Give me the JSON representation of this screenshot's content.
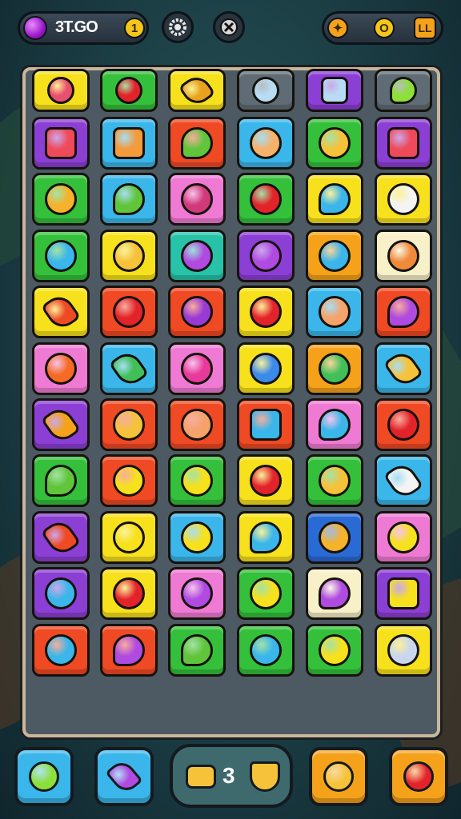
{
  "hud": {
    "score": "3T.GO",
    "coin_value": "1",
    "right_coin": "O",
    "right_square": "LL",
    "gem_color": "#9b18c9",
    "icons": [
      "gem-icon",
      "coin-icon",
      "gear-icon",
      "gear-icon",
      "flag-icon",
      "coin-icon",
      "square-icon"
    ]
  },
  "board": {
    "rows": [
      [
        {
          "bg": "#f7e11d",
          "icon": "plum",
          "c": "#e8516e"
        },
        {
          "bg": "#34c03b",
          "icon": "apple",
          "c": "#e3232a"
        },
        {
          "bg": "#f7e11d",
          "icon": "carrot",
          "c": "#e8a21d"
        },
        {
          "bg": "#4d5a63",
          "icon": "magnifier",
          "c": "#b7dcf4"
        },
        {
          "bg": "#8b3fd4",
          "icon": "battery",
          "c": "#b7dcf4"
        },
        {
          "bg": "#4d5a63",
          "icon": "leaf",
          "c": "#8de03a"
        }
      ],
      [
        {
          "bg": "#8b3fd4",
          "icon": "jar",
          "c": "#ef4a5a"
        },
        {
          "bg": "#3ab6ea",
          "icon": "cake",
          "c": "#f39a3a"
        },
        {
          "bg": "#ef4a24",
          "icon": "leaf",
          "c": "#61c53c"
        },
        {
          "bg": "#3ab6ea",
          "icon": "face",
          "c": "#f5b26b"
        },
        {
          "bg": "#34c03b",
          "icon": "cross",
          "c": "#f5c23a"
        },
        {
          "bg": "#8b3fd4",
          "icon": "frame",
          "c": "#ef4a5a"
        }
      ],
      [
        {
          "bg": "#34c03b",
          "icon": "corn",
          "c": "#f5b22a"
        },
        {
          "bg": "#3ab6ea",
          "icon": "leaf",
          "c": "#61c53c"
        },
        {
          "bg": "#ef7ad4",
          "icon": "bike",
          "c": "#d13a7a"
        },
        {
          "bg": "#34c03b",
          "icon": "tomato",
          "c": "#e3232a"
        },
        {
          "bg": "#f7e11d",
          "icon": "balloon",
          "c": "#3ab6ea"
        },
        {
          "bg": "#f7e11d",
          "icon": "cloud",
          "c": "#f4f4f4"
        }
      ],
      [
        {
          "bg": "#34c03b",
          "icon": "blob",
          "c": "#3ab6ea"
        },
        {
          "bg": "#f7e11d",
          "icon": "bee",
          "c": "#f5c23a"
        },
        {
          "bg": "#27c2a8",
          "icon": "grape",
          "c": "#b04ae0"
        },
        {
          "bg": "#8b3fd4",
          "icon": "plum",
          "c": "#b04ae0"
        },
        {
          "bg": "#f5a21a",
          "icon": "hand",
          "c": "#3ab6ea"
        },
        {
          "bg": "#f7f0c8",
          "icon": "face",
          "c": "#ef8a3a"
        }
      ],
      [
        {
          "bg": "#f7e11d",
          "icon": "carrot",
          "c": "#ef4a24"
        },
        {
          "bg": "#ef4a24",
          "icon": "lantern",
          "c": "#e3232a"
        },
        {
          "bg": "#ef4a24",
          "icon": "berry",
          "c": "#9a3ad4"
        },
        {
          "bg": "#f7e11d",
          "icon": "apple",
          "c": "#e3232a"
        },
        {
          "bg": "#3ab6ea",
          "icon": "face",
          "c": "#f5a26b"
        },
        {
          "bg": "#ef4a24",
          "icon": "balloon",
          "c": "#b04ae0"
        }
      ],
      [
        {
          "bg": "#ef7ad4",
          "icon": "star",
          "c": "#f56a24"
        },
        {
          "bg": "#3ab6ea",
          "icon": "carrot",
          "c": "#41c05a"
        },
        {
          "bg": "#ef7ad4",
          "icon": "apple",
          "c": "#e83a9a"
        },
        {
          "bg": "#f7e11d",
          "icon": "blob",
          "c": "#3a8aea"
        },
        {
          "bg": "#f5a21a",
          "icon": "bottle",
          "c": "#41c05a"
        },
        {
          "bg": "#3ab6ea",
          "icon": "umbrella",
          "c": "#f5c23a"
        }
      ],
      [
        {
          "bg": "#8b3fd4",
          "icon": "key",
          "c": "#f5a21a"
        },
        {
          "bg": "#ef4a24",
          "icon": "corn",
          "c": "#f5c23a"
        },
        {
          "bg": "#ef4a24",
          "icon": "face",
          "c": "#f5a26b"
        },
        {
          "bg": "#ef4a24",
          "icon": "box",
          "c": "#3ab6ea"
        },
        {
          "bg": "#ef7ad4",
          "icon": "balloon",
          "c": "#3ab6ea"
        },
        {
          "bg": "#ef4a24",
          "icon": "tomato",
          "c": "#e3232a"
        }
      ],
      [
        {
          "bg": "#34c03b",
          "icon": "balloon",
          "c": "#61c53c"
        },
        {
          "bg": "#ef4a24",
          "icon": "face",
          "c": "#f7e11d"
        },
        {
          "bg": "#34c03b",
          "icon": "face",
          "c": "#f7e11d"
        },
        {
          "bg": "#f7e11d",
          "icon": "apple",
          "c": "#e3232a"
        },
        {
          "bg": "#34c03b",
          "icon": "coin",
          "c": "#f5c23a"
        },
        {
          "bg": "#3ab6ea",
          "icon": "hammer",
          "c": "#f4f4f4"
        }
      ],
      [
        {
          "bg": "#8b3fd4",
          "icon": "carrot",
          "c": "#ef4a24"
        },
        {
          "bg": "#f7e11d",
          "icon": "duck",
          "c": "#f7e11d"
        },
        {
          "bg": "#3ab6ea",
          "icon": "ring",
          "c": "#f7e11d"
        },
        {
          "bg": "#f7e11d",
          "icon": "balloon",
          "c": "#3ab6ea"
        },
        {
          "bg": "#2a6ad4",
          "icon": "corn",
          "c": "#f5b22a"
        },
        {
          "bg": "#ef7ad4",
          "icon": "face",
          "c": "#f7e11d"
        }
      ],
      [
        {
          "bg": "#8b3fd4",
          "icon": "gem",
          "c": "#3ab6ea"
        },
        {
          "bg": "#f7e11d",
          "icon": "berries",
          "c": "#e3232a"
        },
        {
          "bg": "#ef7ad4",
          "icon": "apple",
          "c": "#b04ae0"
        },
        {
          "bg": "#34c03b",
          "icon": "sun",
          "c": "#f7e11d"
        },
        {
          "bg": "#f7f0c8",
          "icon": "balloon",
          "c": "#b04ae0"
        },
        {
          "bg": "#8b3fd4",
          "icon": "card",
          "c": "#f7e11d"
        }
      ],
      [
        {
          "bg": "#ef4a24",
          "icon": "shield",
          "c": "#3ab6ea"
        },
        {
          "bg": "#ef4a24",
          "icon": "balloon",
          "c": "#b04ae0"
        },
        {
          "bg": "#34c03b",
          "icon": "leaf",
          "c": "#61c53c"
        },
        {
          "bg": "#34c03b",
          "icon": "sun",
          "c": "#3ab6ea"
        },
        {
          "bg": "#34c03b",
          "icon": "sun",
          "c": "#f7e11d"
        },
        {
          "bg": "#f7e11d",
          "icon": "face",
          "c": "#c9d6ee"
        }
      ]
    ]
  },
  "bottom_bar": {
    "count": "3",
    "buttons": [
      {
        "name": "avocado-booster-button",
        "bg": "#3ab6ea",
        "icon": "avocado-icon",
        "c": "#8de03a"
      },
      {
        "name": "pencil-booster-button",
        "bg": "#3ab6ea",
        "icon": "pencil-icon",
        "c": "#b04ae0"
      },
      {
        "name": "figure-booster-button",
        "bg": "#f5a21a",
        "icon": "figure-icon",
        "c": "#f5c23a"
      },
      {
        "name": "fruit-booster-button",
        "bg": "#f5a21a",
        "icon": "fruit-basket-icon",
        "c": "#e3232a"
      }
    ]
  }
}
